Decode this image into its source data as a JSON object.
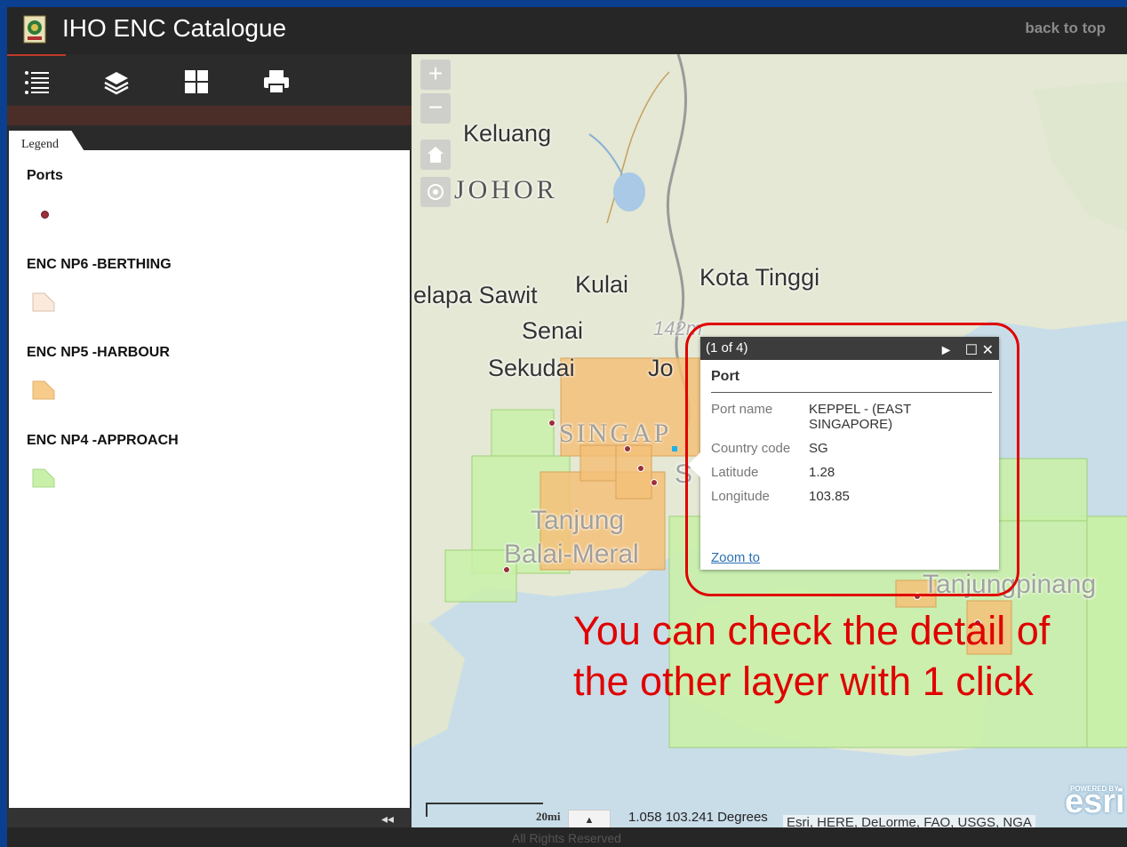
{
  "header": {
    "title": "IHO ENC Catalogue",
    "back_to_top": "back to top"
  },
  "toolbar": {
    "tools": [
      "legend-icon",
      "layers-icon",
      "basemap-gallery-icon",
      "print-icon"
    ]
  },
  "legend": {
    "tab_label": "Legend",
    "layers": [
      {
        "title": "Ports",
        "symbol": "point",
        "color": "#9a2f3a"
      },
      {
        "title": "ENC NP6 -BERTHING",
        "symbol": "polygon",
        "color": "#fbe9dc"
      },
      {
        "title": "ENC NP5 -HARBOUR",
        "symbol": "polygon",
        "color": "#f7cc8a"
      },
      {
        "title": "ENC NP4 -APPROACH",
        "symbol": "polygon",
        "color": "#c9f0a8"
      }
    ]
  },
  "map": {
    "places": {
      "keluang": "Keluang",
      "johor": "JOHOR",
      "kulai": "Kulai",
      "kota_tinggi": "Kota Tinggi",
      "kelapa_sawit": "elapa Sawit",
      "senai": "Senai",
      "sekudai": "Sekudai",
      "singapore": "SINGAP",
      "tanjung_balai": "Tanjung",
      "balai_meral": "Balai-Meral",
      "tanjungpinang": "Tanjungpinang",
      "elev": "142m",
      "jo": "Jo",
      "s": "S"
    },
    "zoom_in": "+",
    "zoom_out": "−",
    "scale_label": "20mi",
    "coords": "1.058  103.241 Degrees",
    "attribution": "Esri, HERE, DeLorme, FAO, USGS, NGA",
    "esri_powered": "POWERED BY",
    "esri_logo": "esri"
  },
  "popup": {
    "counter": "(1 of 4)",
    "title": "Port",
    "attributes": [
      {
        "key": "Port name",
        "value": "KEPPEL - (EAST SINGAPORE)"
      },
      {
        "key": "Country code",
        "value": "SG"
      },
      {
        "key": "Latitude",
        "value": "1.28"
      },
      {
        "key": "Longitude",
        "value": "103.85"
      }
    ],
    "zoom_to": "Zoom to"
  },
  "annotation": {
    "line1": "You can check the detail of",
    "line2": "the other layer with 1 click"
  },
  "footer": {
    "text": "All Rights Reserved"
  }
}
